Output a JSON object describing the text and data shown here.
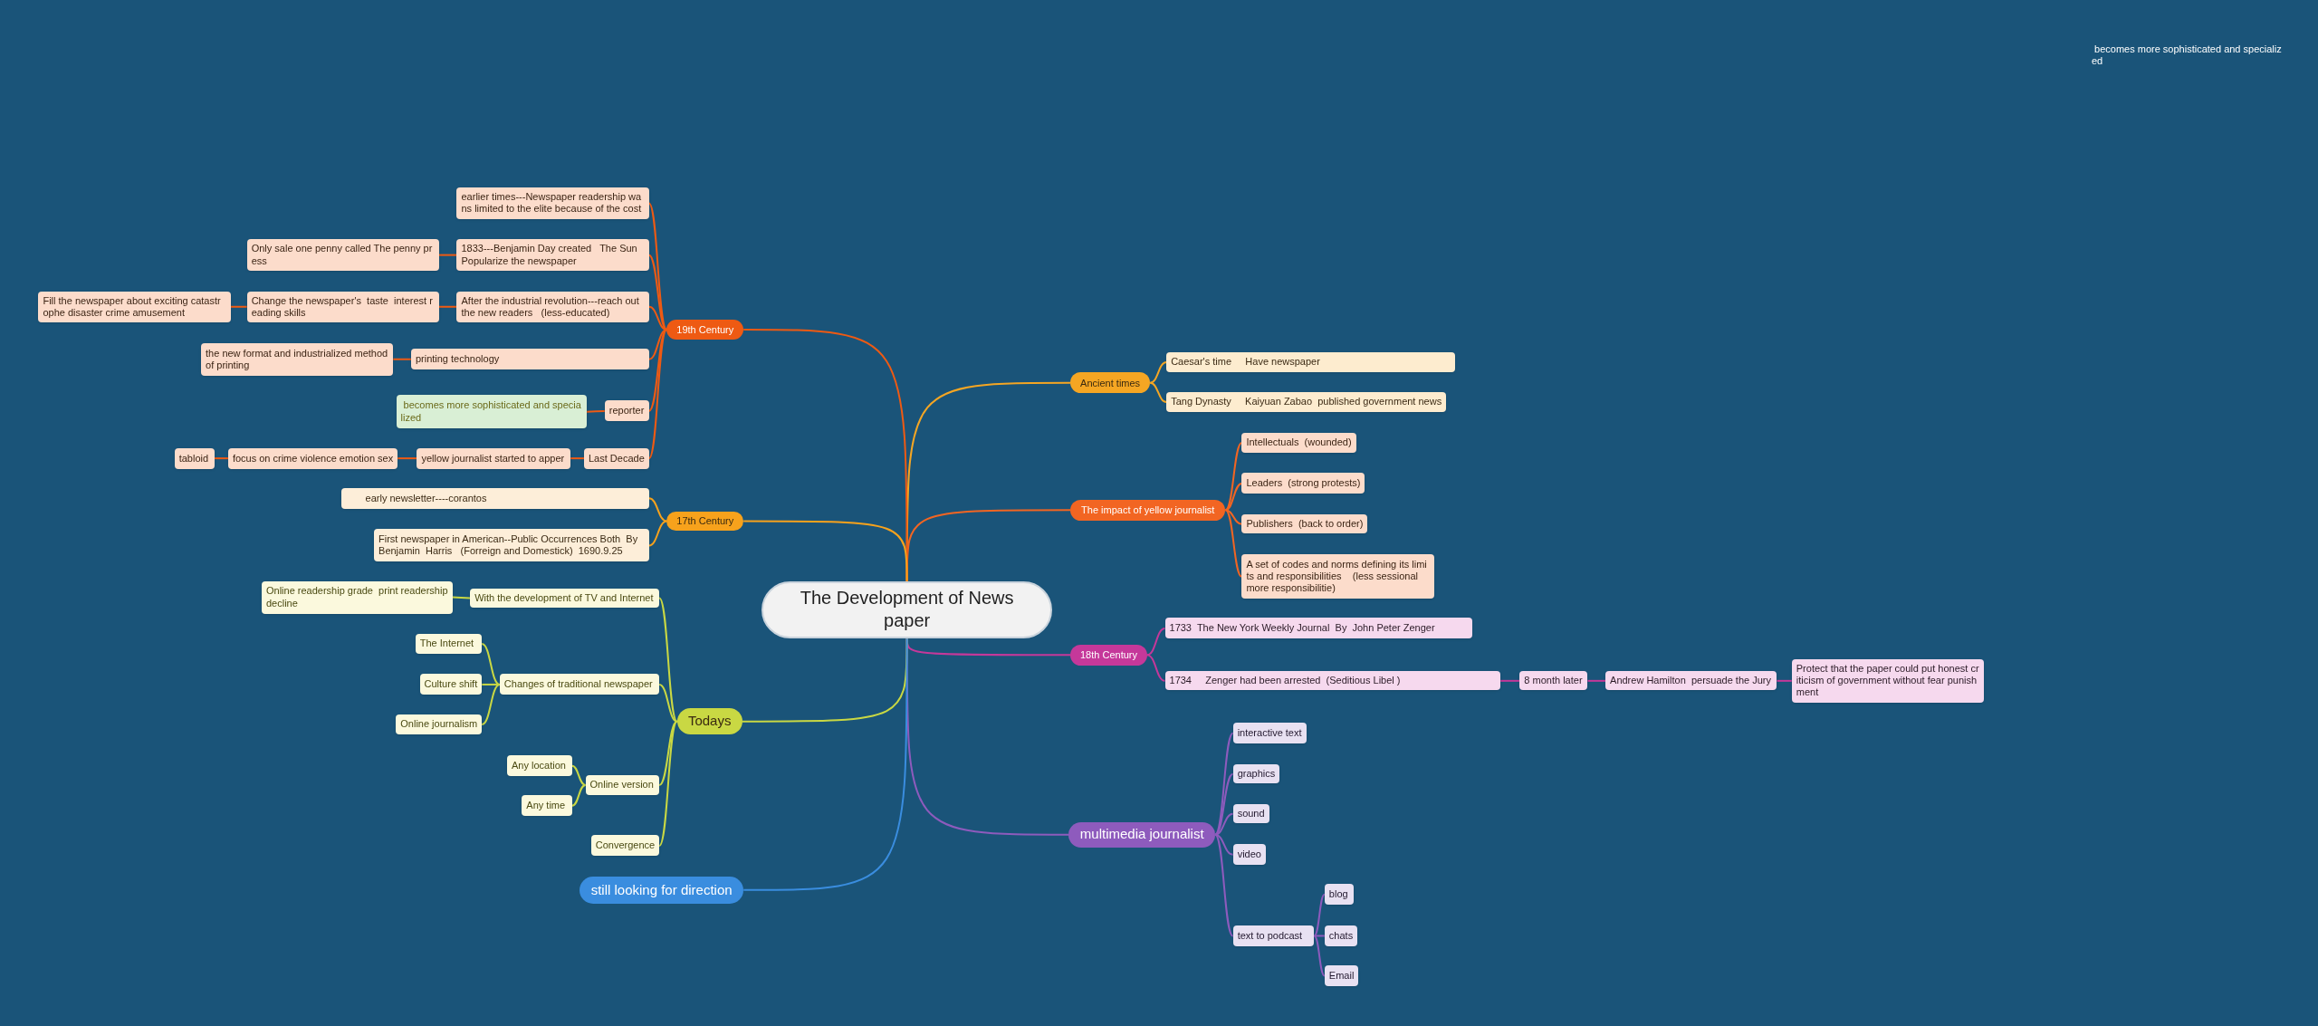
{
  "central_topic": "The Development of Newspaper",
  "branches": [
    {
      "label": "Ancient times",
      "color": "#f5a623",
      "children": [
        {
          "label": "Caesar's time     Have newspaper"
        },
        {
          "label": "Tang Dynasty     Kaiyuan Zabao  published government news"
        }
      ]
    },
    {
      "label": "The impact of yellow journalist",
      "color": "#f26522",
      "children": [
        {
          "label": "Intellectuals  (wounded)"
        },
        {
          "label": "Leaders  (strong protests)"
        },
        {
          "label": "Publishers  (back to order)"
        },
        {
          "label": "A set of codes and norms defining its limits and responsibilities    (less sessional  more responsibilitie)"
        }
      ]
    },
    {
      "label": "18th Century",
      "color": "#c5389a",
      "children": [
        {
          "label": "1733  The New York Weekly Journal  By  John Peter Zenger"
        },
        {
          "label": "1734     Zenger had been arrested  (Seditious Libel )",
          "children": [
            {
              "label": "8 month later",
              "children": [
                {
                  "label": "Andrew Hamilton  persuade the Jury",
                  "children": [
                    {
                      "label": "Protect that the paper could put honest criticism of government without fear punishment"
                    }
                  ]
                }
              ]
            }
          ]
        }
      ]
    },
    {
      "label": "multimedia journalist",
      "color": "#8e5bbd",
      "children": [
        {
          "label": "interactive text"
        },
        {
          "label": "graphics"
        },
        {
          "label": "sound"
        },
        {
          "label": "video"
        },
        {
          "label": "text to podcast",
          "children": [
            {
              "label": "blog"
            },
            {
              "label": "chats"
            },
            {
              "label": "Email"
            }
          ]
        }
      ]
    },
    {
      "label": "19th Century",
      "color": "#ee5a13",
      "children": [
        {
          "label": "earlier times---Newspaper readership wans limited to the elite because of the cost"
        },
        {
          "label": "1833---Benjamin Day created   The Sun  Popularize the newspaper",
          "children": [
            {
              "label": "Only sale one penny called The penny press"
            }
          ]
        },
        {
          "label": "After the industrial revolution---reach out  the new readers   (less-educated)",
          "children": [
            {
              "label": "Change the newspaper's  taste  interest reading skills",
              "children": [
                {
                  "label": "Fill the newspaper about exciting catastrophe disaster crime amusement"
                }
              ]
            }
          ]
        },
        {
          "label": "printing technology",
          "children": [
            {
              "label": "the new format and industrialized method of printing"
            }
          ]
        },
        {
          "label": "reporter",
          "children": [
            {
              "label": " becomes more sophisticated and specialized",
              "kind": "highlight"
            }
          ]
        },
        {
          "label": "Last Decade",
          "children": [
            {
              "label": "yellow journalist started to apper",
              "children": [
                {
                  "label": "focus on crime violence emotion sex",
                  "children": [
                    {
                      "label": "tabloid"
                    }
                  ]
                }
              ]
            }
          ]
        }
      ]
    },
    {
      "label": "17th Century",
      "color": "#f7a21c",
      "children": [
        {
          "label": "       early newsletter----corantos"
        },
        {
          "label": "First newspaper in American--Public Occurrences Both  By Benjamin  Harris   (Forreign and Domestick)  1690.9.25"
        }
      ]
    },
    {
      "label": "Todays",
      "color": "#c9d843",
      "children": [
        {
          "label": "With the development of TV and Internet",
          "children": [
            {
              "label": "Online readership grade  print readership decline"
            }
          ]
        },
        {
          "label": "Changes of traditional newspaper",
          "children": [
            {
              "label": "The Internet"
            },
            {
              "label": "Culture shift"
            },
            {
              "label": "Online journalism"
            }
          ]
        },
        {
          "label": "Online version",
          "children": [
            {
              "label": "Any location"
            },
            {
              "label": "Any time"
            }
          ]
        },
        {
          "label": "Convergence"
        }
      ]
    },
    {
      "label": "still looking for direction",
      "color": "#3a8ddf"
    }
  ],
  "floating_note": " becomes more sophisticated and specialized"
}
